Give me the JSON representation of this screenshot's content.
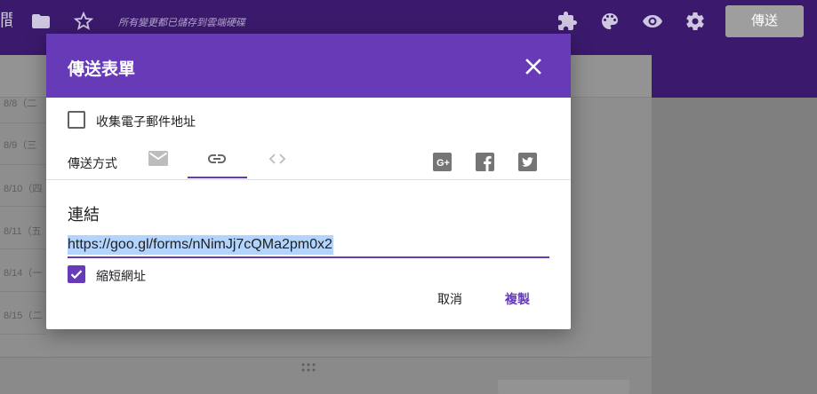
{
  "topbar": {
    "title_fragment": "間",
    "saved_status": "所有變更都已儲存到雲端硬碟",
    "send_label": "傳送",
    "icons": [
      "folder-icon",
      "star-icon",
      "addons-icon",
      "palette-icon",
      "preview-eye-icon",
      "settings-gear-icon"
    ]
  },
  "background": {
    "rows": [
      "8/8（二",
      "8/9（三",
      "8/10（四",
      "8/11（五",
      "8/14（一",
      "8/15（二"
    ]
  },
  "dialog": {
    "title": "傳送表單",
    "collect_email_label": "收集電子郵件地址",
    "collect_email_checked": false,
    "send_via_label": "傳送方式",
    "tabs": [
      {
        "icon": "email-icon",
        "selected": false
      },
      {
        "icon": "link-icon",
        "selected": true
      },
      {
        "icon": "embed-code-icon",
        "selected": false
      }
    ],
    "share_icons": [
      "google-plus-icon",
      "facebook-icon",
      "twitter-icon"
    ],
    "link_section_title": "連結",
    "link_url": "https://goo.gl/forms/nNimJj7cQMa2pm0x2",
    "shorten_label": "縮短網址",
    "shorten_checked": true,
    "cancel_label": "取消",
    "copy_label": "複製"
  },
  "colors": {
    "accent": "#673ab7",
    "topbar": "#3b1a6d",
    "scrim_bg": "#8d8d8d",
    "selection": "#b3d4fc"
  }
}
